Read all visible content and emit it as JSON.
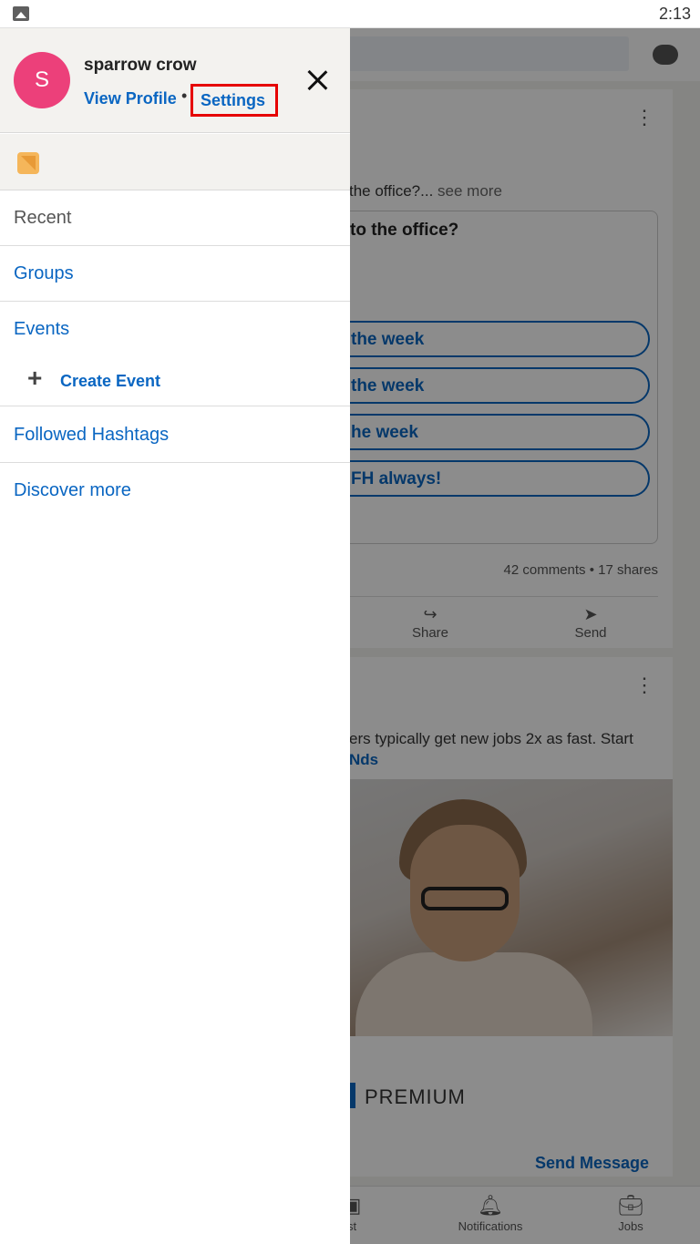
{
  "status_bar": {
    "time": "2:13"
  },
  "drawer": {
    "avatar_initial": "S",
    "username": "sparrow crow",
    "view_profile": "View Profile",
    "separator": "•",
    "settings": "Settings",
    "menu": {
      "recent": "Recent",
      "groups": "Groups",
      "events": "Events",
      "create_event": "Create Event",
      "followed_hashtags": "Followed Hashtags",
      "discover_more": "Discover more"
    }
  },
  "feed": {
    "post1": {
      "snippet": "the office?...",
      "see_more": "see more",
      "poll_question": "to the office?",
      "poll_options": [
        "the week",
        " the week",
        "he week",
        "FH always!"
      ],
      "stats": "42 comments • 17 shares",
      "actions": {
        "share": "Share",
        "send": "Send"
      }
    },
    "post2": {
      "text_line1": "ers typically get new jobs 2x as fast. Start",
      "text_line2": "Nds",
      "brand": "PREMIUM",
      "cta": "Send Message"
    }
  },
  "bottom_nav": {
    "post": "st",
    "notifications": "Notifications",
    "jobs": "Jobs"
  }
}
